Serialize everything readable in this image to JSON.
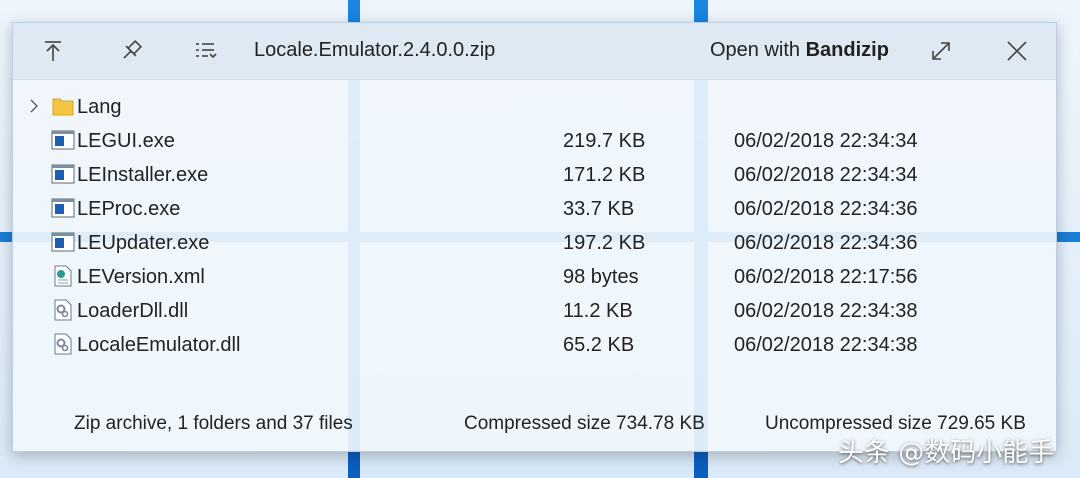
{
  "window": {
    "title": "Locale.Emulator.2.4.0.0.zip",
    "open_with_prefix": "Open with ",
    "open_with_app": "Bandizip"
  },
  "toolbar": {
    "up_icon": "up-arrow-icon",
    "pin_icon": "pin-icon",
    "view_icon": "list-view-icon",
    "expand_icon": "expand-icon",
    "close_icon": "close-icon"
  },
  "files": [
    {
      "name": "Lang",
      "size": "",
      "date": "",
      "icon": "folder-icon"
    },
    {
      "name": "LEGUI.exe",
      "size": "219.7 KB",
      "date": "06/02/2018 22:34:34",
      "icon": "exe-icon"
    },
    {
      "name": "LEInstaller.exe",
      "size": "171.2 KB",
      "date": "06/02/2018 22:34:34",
      "icon": "exe-icon"
    },
    {
      "name": "LEProc.exe",
      "size": "33.7 KB",
      "date": "06/02/2018 22:34:36",
      "icon": "exe-icon"
    },
    {
      "name": "LEUpdater.exe",
      "size": "197.2 KB",
      "date": "06/02/2018 22:34:36",
      "icon": "exe-icon"
    },
    {
      "name": "LEVersion.xml",
      "size": "98 bytes",
      "date": "06/02/2018 22:17:56",
      "icon": "xml-icon"
    },
    {
      "name": "LoaderDll.dll",
      "size": "11.2 KB",
      "date": "06/02/2018 22:34:38",
      "icon": "dll-icon"
    },
    {
      "name": "LocaleEmulator.dll",
      "size": "65.2 KB",
      "date": "06/02/2018 22:34:38",
      "icon": "dll-icon"
    }
  ],
  "status": {
    "summary": "Zip archive, 1 folders and 37 files",
    "compressed": "Compressed size 734.78 KB",
    "uncompressed": "Uncompressed size 729.65 KB"
  },
  "watermark": "头条 @数码小能手",
  "colors": {
    "desktop_blue": "#1478d4",
    "window_bg": "#f0f6fc",
    "titlebar_bg": "#dee8f2",
    "exe_blue": "#1a5fb4",
    "folder_yellow": "#f4c542"
  }
}
